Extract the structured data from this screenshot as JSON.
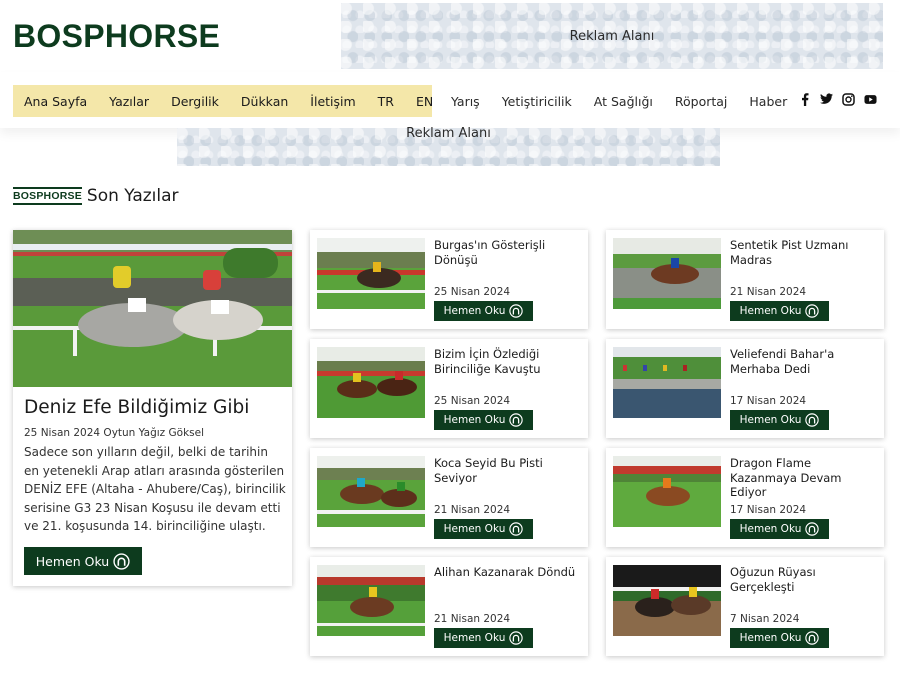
{
  "brand": {
    "logo": "BOSPHORSE",
    "colors": {
      "primary": "#0d3b1e",
      "nav_highlight": "#f4e7a9"
    }
  },
  "ads": {
    "top_label": "Reklam Alanı",
    "mid_label": "Reklam Alanı"
  },
  "nav": {
    "primary": [
      "Ana Sayfa",
      "Yazılar",
      "Dergilik",
      "Dükkan",
      "İletişim",
      "TR",
      "EN"
    ],
    "secondary": [
      "Yarış",
      "Yetiştiricilik",
      "At Sağlığı",
      "Röportaj",
      "Haber"
    ],
    "social": [
      "facebook-icon",
      "twitter-icon",
      "instagram-icon",
      "youtube-icon"
    ]
  },
  "section": {
    "brand": "BOSPHORSE",
    "title": "Son Yazılar"
  },
  "featured": {
    "title": "Deniz Efe Bildiğimiz Gibi",
    "meta": "25 Nisan 2024 Oytun Yağız Göksel",
    "excerpt": "Sadece son yılların değil, belki de tarihin en yetenekli Arap atları arasında gösterilen DENİZ EFE (Altaha - Ahubere/Caş), birincilik serisine G3 23 Nisan Koşusu ile devam etti ve 21. koşusunda 14. birinciliğine ulaştı.",
    "button": "Hemen Oku"
  },
  "articles": [
    {
      "title": "Burgas'ın Gösterişli Dönüşü",
      "date": "25 Nisan 2024",
      "button": "Hemen Oku"
    },
    {
      "title": "Sentetik Pist Uzmanı Madras",
      "date": "21 Nisan 2024",
      "button": "Hemen Oku"
    },
    {
      "title": "Bizim İçin Özlediği Birinciliğe Kavuştu",
      "date": "25 Nisan 2024",
      "button": "Hemen Oku"
    },
    {
      "title": "Veliefendi Bahar'a Merhaba Dedi",
      "date": "17 Nisan 2024",
      "button": "Hemen Oku"
    },
    {
      "title": "Koca Seyid Bu Pisti Seviyor",
      "date": "21 Nisan 2024",
      "button": "Hemen Oku"
    },
    {
      "title": "Dragon Flame Kazanmaya Devam Ediyor",
      "date": "17 Nisan 2024",
      "button": "Hemen Oku"
    },
    {
      "title": "Alihan Kazanarak Döndü",
      "date": "21 Nisan 2024",
      "button": "Hemen Oku"
    },
    {
      "title": "Oğuzun Rüyası Gerçekleşti",
      "date": "7 Nisan 2024",
      "button": "Hemen Oku"
    }
  ]
}
